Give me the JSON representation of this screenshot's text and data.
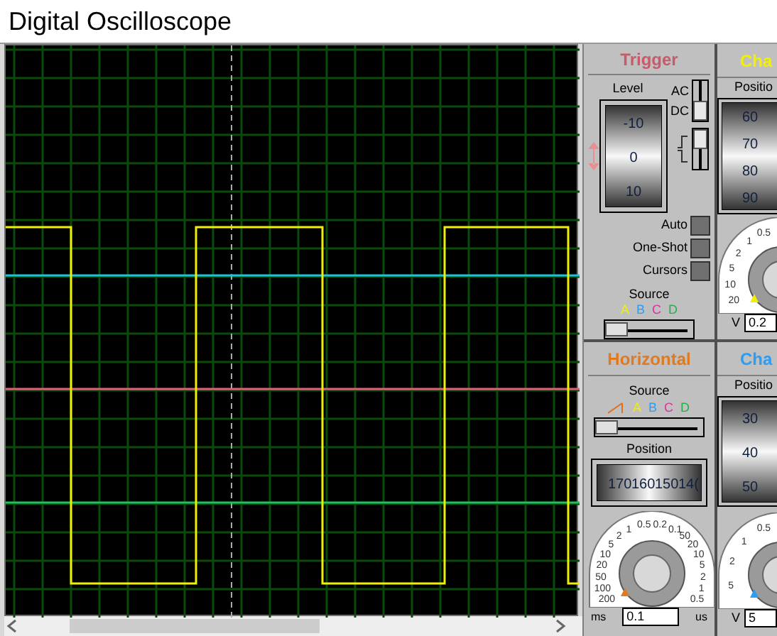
{
  "window": {
    "title": "Digital Oscilloscope"
  },
  "trigger": {
    "title": "Trigger",
    "level_label": "Level",
    "level_scale": [
      "-10",
      "0",
      "10"
    ],
    "coupling": [
      {
        "label": "AC",
        "selected": false
      },
      {
        "label": "DC",
        "selected": true
      }
    ],
    "edge_switch": {
      "on": true
    },
    "buttons": [
      {
        "label": "Auto"
      },
      {
        "label": "One-Shot"
      },
      {
        "label": "Cursors"
      }
    ],
    "source_label": "Source",
    "sources": [
      {
        "label": "A",
        "color": "#f0f000"
      },
      {
        "label": "B",
        "color": "#2a9df4"
      },
      {
        "label": "C",
        "color": "#e0309a"
      },
      {
        "label": "D",
        "color": "#22b04a"
      }
    ],
    "source_slider": {
      "level": 0
    }
  },
  "channel_a": {
    "title": "Cha",
    "position_label": "Positio",
    "scale": [
      "60",
      "70",
      "80",
      "90"
    ],
    "dial": [
      "0.5",
      "1",
      "2",
      "5",
      "10",
      "20"
    ],
    "unit": "V",
    "value": "0.2"
  },
  "horizontal": {
    "title": "Horizontal",
    "source_label": "Source",
    "sources": [
      {
        "label": "A",
        "color": "#f0f000"
      },
      {
        "label": "B",
        "color": "#2a9df4"
      },
      {
        "label": "C",
        "color": "#e0309a"
      },
      {
        "label": "D",
        "color": "#22b04a"
      }
    ],
    "source_slider": {
      "level": 0
    },
    "position_label": "Position",
    "scale": [
      "170",
      "160",
      "150",
      "14("
    ],
    "dial": [
      "1",
      "0.5",
      "0.2",
      "0.1",
      "2",
      "50",
      "5",
      "20",
      "10",
      "10",
      "20",
      "5",
      "50",
      "2",
      "100",
      "1",
      "200",
      "0.5"
    ],
    "unit_left": "ms",
    "unit_right": "us",
    "value": "0.1"
  },
  "channel_b": {
    "title": "Cha",
    "position_label": "Positio",
    "scale": [
      "30",
      "40",
      "50"
    ],
    "dial": [
      "0.5",
      "1",
      "2",
      "5"
    ],
    "unit": "V",
    "value": "5"
  }
}
